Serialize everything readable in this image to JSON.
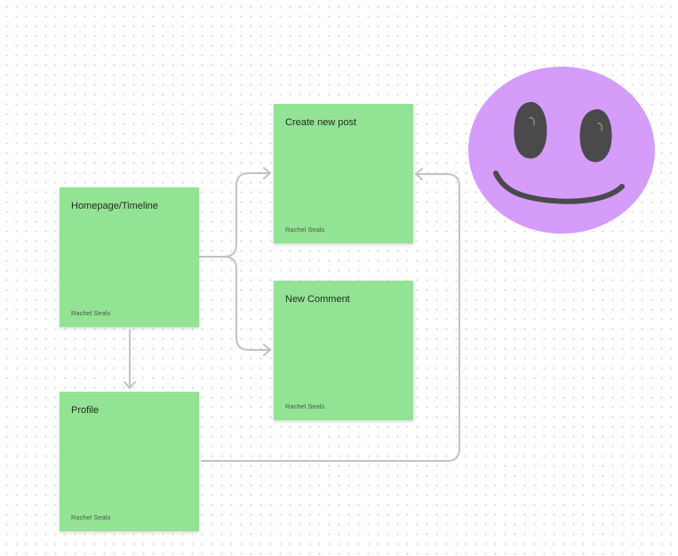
{
  "colors": {
    "sticky_fill": "#93e394",
    "connector_stroke": "#c2c2c2",
    "face_fill": "#d59cfa",
    "marker_ink": "#4a4a4a",
    "canvas_dots": "#d6d6d6"
  },
  "notes": {
    "homepage": {
      "title": "Homepage/Timeline",
      "author": "Rachel Seals"
    },
    "profile": {
      "title": "Profile",
      "author": "Rachel Seals"
    },
    "create_post": {
      "title": "Create new post",
      "author": "Rachel Seals"
    },
    "new_comment": {
      "title": "New Comment",
      "author": "Rachel Seals"
    }
  },
  "connectors": [
    {
      "from": "Homepage/Timeline",
      "to": "Create new post"
    },
    {
      "from": "Homepage/Timeline",
      "to": "New Comment"
    },
    {
      "from": "Homepage/Timeline",
      "to": "Profile"
    },
    {
      "from": "Profile",
      "to": "Create new post"
    }
  ],
  "drawings": [
    {
      "shape": "ellipse",
      "icon": "smiley-face-doodle-icon",
      "color": "#d59cfa"
    }
  ]
}
